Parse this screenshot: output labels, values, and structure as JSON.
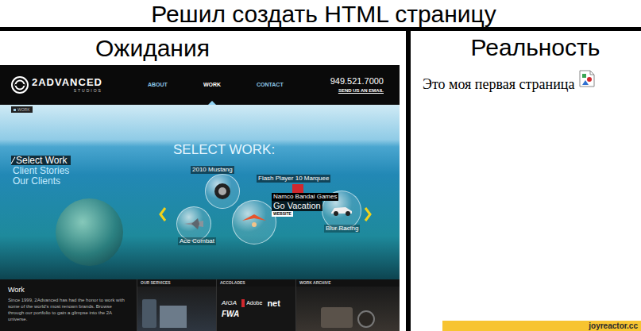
{
  "title": "Решил создать HTML страницу",
  "expectation": {
    "label": "Ожидания",
    "site": {
      "logo": {
        "name": "2ADVANCED",
        "sub": "STUDIOS"
      },
      "nav": [
        {
          "label": "ABOUT",
          "selected": false
        },
        {
          "label": "WORK",
          "selected": true
        },
        {
          "label": "CONTACT",
          "selected": false
        }
      ],
      "phone": "949.521.7000",
      "email_link": "SEND US AN EMAIL",
      "breadcrumb": "WORK",
      "heading": "SELECT WORK:",
      "side_menu": [
        {
          "label": "Select Work",
          "selected": true
        },
        {
          "label": "Client Stories",
          "selected": false
        },
        {
          "label": "Our Clients",
          "selected": false
        }
      ],
      "carousel": [
        "2010 Mustang",
        "Flash Player 10 Marquee",
        "Blur Racing",
        "Ace Combat"
      ],
      "featured": {
        "client": "Namco Bandai Games",
        "title": "Go Vacation",
        "tag": "WEBSITE"
      },
      "sections": [
        "OUR SERVICES",
        "ACCOLADES",
        "WORK ARCHIVE"
      ],
      "intro": {
        "heading": "Work",
        "text": "Since 1999, 2Advanced has had the honor to work with some of the world's most renown brands. Browse through our portfolio to gain a glimpse into the 2A universe."
      },
      "accolade_logos": [
        "AIGA",
        "Adobe",
        "net",
        "FWA"
      ]
    }
  },
  "reality": {
    "label": "Реальность",
    "page_text": "Это моя первая страница"
  },
  "watermark": "joyreactor.cc"
}
